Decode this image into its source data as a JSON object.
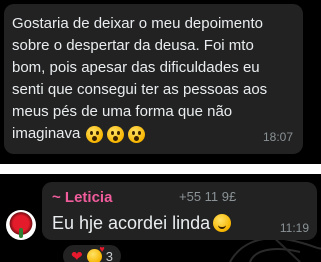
{
  "message1": {
    "text": "Gostaria de deixar o meu depoimento\nsobre o despertar da deusa. Foi mto\nbom, pois apesar das dificuldades eu\nsenti que consegui ter as pessoas aos\nmeus pés de uma forma que não\nimaginava",
    "emojis": [
      "astonished-face-icon",
      "astonished-face-icon",
      "astonished-face-icon"
    ],
    "time": "18:07"
  },
  "message2": {
    "sender_name": "~ Leticia",
    "sender_phone": "+55 11 9£",
    "text": "Eu hje acordei linda",
    "emoji": "shy-smiling-face-icon",
    "time": "11:19",
    "reactions": {
      "icons": [
        "red-heart-icon",
        "smiling-face-with-hearts-icon"
      ],
      "count": "3"
    }
  },
  "colors": {
    "background": "#000000",
    "bubble": "#222222",
    "sender_name": "#f15c9c",
    "text": "#e9edef",
    "meta": "#8a9296"
  }
}
